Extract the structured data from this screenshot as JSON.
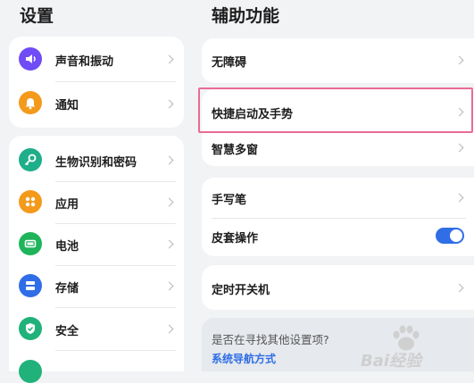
{
  "left_panel": {
    "title": "设置",
    "group1": [
      {
        "label": "声音和振动",
        "icon": "speaker-icon",
        "icon_color": "#6f4cf5"
      },
      {
        "label": "通知",
        "icon": "bell-icon",
        "icon_color": "#f39a1b"
      }
    ],
    "group2": [
      {
        "label": "生物识别和密码",
        "icon": "key-icon",
        "icon_color": "#1fae8a"
      },
      {
        "label": "应用",
        "icon": "apps-icon",
        "icon_color": "#f39a1b"
      },
      {
        "label": "电池",
        "icon": "battery-icon",
        "icon_color": "#1fb45a"
      },
      {
        "label": "存储",
        "icon": "storage-icon",
        "icon_color": "#2f6ee6"
      },
      {
        "label": "安全",
        "icon": "shield-icon",
        "icon_color": "#20b27a"
      }
    ]
  },
  "right_panel": {
    "title": "辅助功能",
    "items": {
      "accessibility": "无障碍",
      "quick_launch": "快捷启动及手势",
      "smart_window": "智慧多窗",
      "stylus": "手写笔",
      "cover_operation": "皮套操作",
      "scheduled_power": "定时开关机"
    },
    "cover_toggle_on": true,
    "suggestion": {
      "question": "是否在寻找其他设置项?",
      "link": "系统导航方式"
    }
  },
  "watermark": {
    "text": "Bai经验"
  },
  "colors": {
    "accent": "#2f6ee6",
    "highlight_border": "#e96b93",
    "background": "#f1f3f5"
  }
}
